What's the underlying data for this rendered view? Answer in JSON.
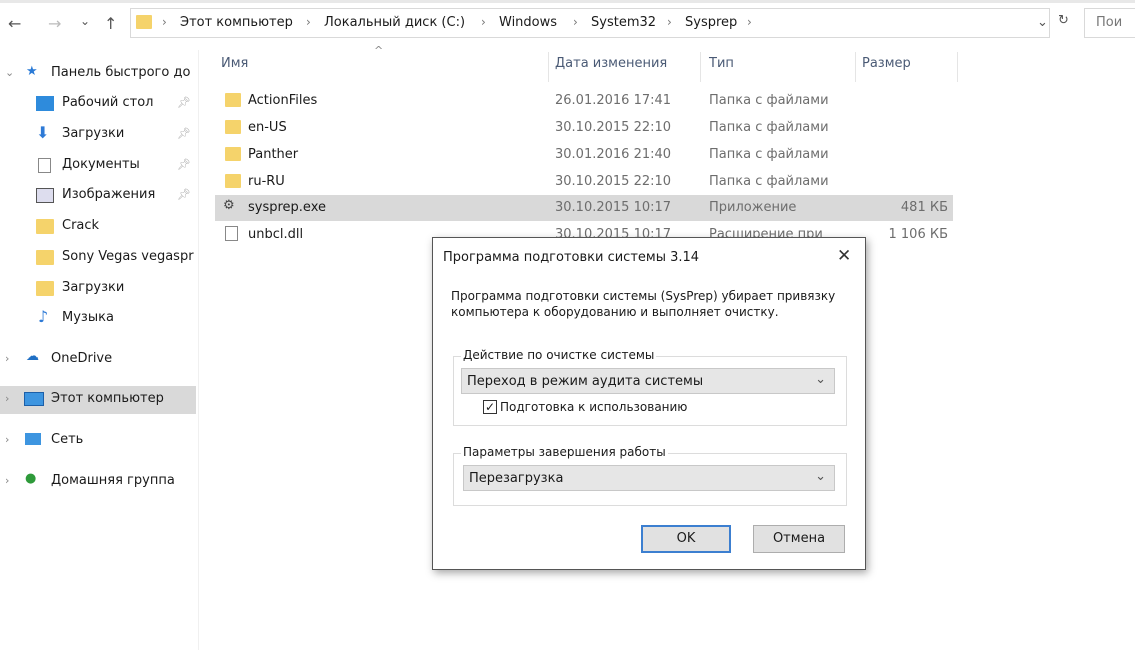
{
  "nav": {
    "back": "←",
    "forward": "→",
    "recent": "⌄",
    "up": "↑"
  },
  "breadcrumb": [
    "Этот компьютер",
    "Локальный диск (C:)",
    "Windows",
    "System32",
    "Sysprep"
  ],
  "search": {
    "placeholder": "Пои"
  },
  "sidebar": {
    "quick_access": "Панель быстрого до",
    "items": [
      {
        "label": "Рабочий стол",
        "icon": "desktop-icon",
        "pinned": true
      },
      {
        "label": "Загрузки",
        "icon": "download-icon",
        "pinned": true
      },
      {
        "label": "Документы",
        "icon": "document-icon",
        "pinned": true
      },
      {
        "label": "Изображения",
        "icon": "pictures-icon",
        "pinned": true
      },
      {
        "label": "Crack",
        "icon": "folder-icon"
      },
      {
        "label": "Sony Vegas vegaspr",
        "icon": "folder-icon"
      },
      {
        "label": "Загрузки",
        "icon": "folder-icon"
      },
      {
        "label": "Музыка",
        "icon": "music-icon"
      }
    ],
    "onedrive": "OneDrive",
    "this_pc": "Этот компьютер",
    "network": "Сеть",
    "homegroup": "Домашняя группа"
  },
  "columns": {
    "name": "Имя",
    "date": "Дата изменения",
    "type": "Тип",
    "size": "Размер"
  },
  "files": [
    {
      "name": "ActionFiles",
      "date": "26.01.2016 17:41",
      "type": "Папка с файлами",
      "size": ""
    },
    {
      "name": "en-US",
      "date": "30.10.2015 22:10",
      "type": "Папка с файлами",
      "size": ""
    },
    {
      "name": "Panther",
      "date": "30.01.2016 21:40",
      "type": "Папка с файлами",
      "size": ""
    },
    {
      "name": "ru-RU",
      "date": "30.10.2015 22:10",
      "type": "Папка с файлами",
      "size": ""
    },
    {
      "name": "sysprep.exe",
      "date": "30.10.2015 10:17",
      "type": "Приложение",
      "size": "481 КБ"
    },
    {
      "name": "unbcl.dll",
      "date": "30.10.2015 10:17",
      "type": "Расширение при",
      "size": "1 106 КБ"
    }
  ],
  "dialog": {
    "title": "Программа подготовки системы 3.14",
    "desc1": "Программа подготовки системы (SysPrep) убирает привязку",
    "desc2": "компьютера к оборудованию и выполняет очистку.",
    "group1": "Действие по очистке системы",
    "action": "Переход в режим аудита системы",
    "checkbox": "Подготовка к использованию",
    "checked": true,
    "group2": "Параметры завершения работы",
    "shutdown": "Перезагрузка",
    "ok": "OK",
    "cancel": "Отмена"
  }
}
